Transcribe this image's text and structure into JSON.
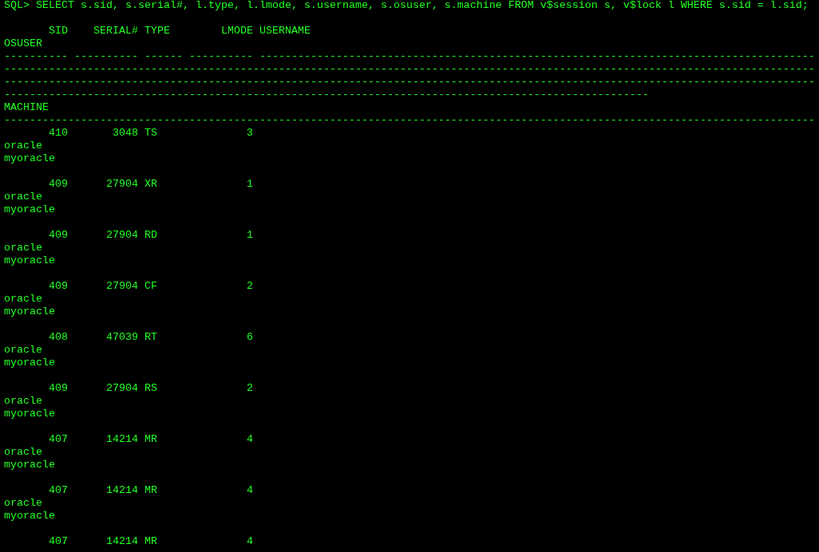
{
  "command": "SQL> SELECT s.sid, s.serial#, l.type, l.lmode, s.username, s.osuser, s.machine FROM v$session s, v$lock l WHERE s.sid = l.sid;",
  "columns": [
    "SID",
    "SERIAL#",
    "TYPE",
    "LMODE",
    "USERNAME",
    "OSUSER",
    "MACHINE"
  ],
  "separator_lines": [
    "---------- ---------- ------ ---------- ---------------------------------------------------------------------------------------",
    "-------------------------------------------------------------------------------------------------------------------------------",
    "-------------------------------------------------------------------------------------------------------------------------------",
    "-----------------------------------------------------------------------------------------------------"
  ],
  "machine_separator": "-------------------------------------------------------------------------------------------------------------------------------",
  "rows": [
    {
      "sid": "410",
      "serial": "3048",
      "type": "TS",
      "lmode": "3",
      "osuser": "oracle",
      "machine": "myoracle"
    },
    {
      "sid": "409",
      "serial": "27904",
      "type": "XR",
      "lmode": "1",
      "osuser": "oracle",
      "machine": "myoracle"
    },
    {
      "sid": "409",
      "serial": "27904",
      "type": "RD",
      "lmode": "1",
      "osuser": "oracle",
      "machine": "myoracle"
    },
    {
      "sid": "409",
      "serial": "27904",
      "type": "CF",
      "lmode": "2",
      "osuser": "oracle",
      "machine": "myoracle"
    },
    {
      "sid": "408",
      "serial": "47039",
      "type": "RT",
      "lmode": "6",
      "osuser": "oracle",
      "machine": "myoracle"
    },
    {
      "sid": "409",
      "serial": "27904",
      "type": "RS",
      "lmode": "2",
      "osuser": "oracle",
      "machine": "myoracle"
    },
    {
      "sid": "407",
      "serial": "14214",
      "type": "MR",
      "lmode": "4",
      "osuser": "oracle",
      "machine": "myoracle"
    },
    {
      "sid": "407",
      "serial": "14214",
      "type": "MR",
      "lmode": "4",
      "osuser": "oracle",
      "machine": "myoracle"
    },
    {
      "sid": "407",
      "serial": "14214",
      "type": "MR",
      "lmode": "4"
    }
  ]
}
